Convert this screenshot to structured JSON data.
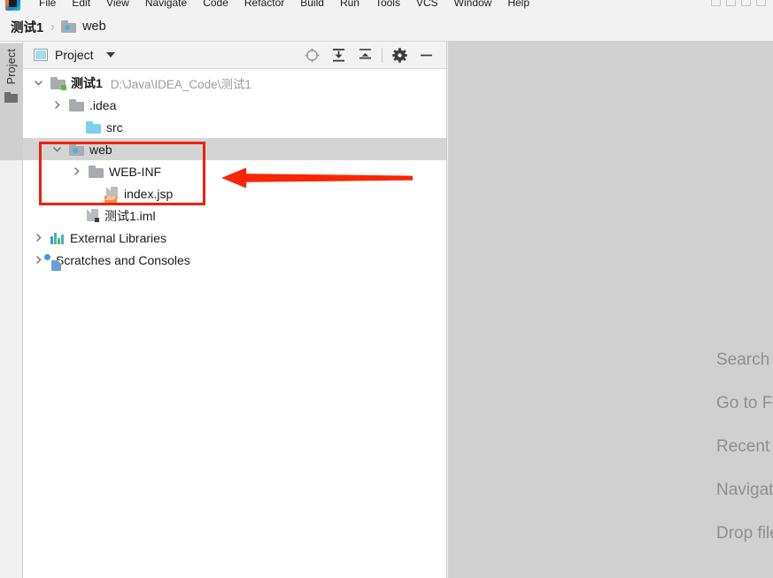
{
  "window": {
    "menu_items": [
      {
        "label": "File",
        "mnemonic": "F"
      },
      {
        "label": "Edit",
        "mnemonic": "E"
      },
      {
        "label": "View",
        "mnemonic": "V"
      },
      {
        "label": "Navigate",
        "mnemonic": "N"
      },
      {
        "label": "Code",
        "mnemonic": "C"
      },
      {
        "label": "Refactor",
        "mnemonic": "R"
      },
      {
        "label": "Build",
        "mnemonic": "B"
      },
      {
        "label": "Run",
        "mnemonic": "R"
      },
      {
        "label": "Tools",
        "mnemonic": "T"
      },
      {
        "label": "VCS",
        "mnemonic": "S"
      },
      {
        "label": "Window",
        "mnemonic": "W"
      },
      {
        "label": "Help",
        "mnemonic": "H"
      }
    ]
  },
  "navbar": {
    "root": "测试1",
    "separator": "›",
    "current": "web",
    "current_icon": "web-folder-icon"
  },
  "toolstrip": {
    "project_button_label": "Project",
    "project_button_icon": "project-folder-icon"
  },
  "project_panel": {
    "title": "Project",
    "title_icon": "project-view-icon",
    "dropdown_icon": "chevron-down-icon",
    "tools": [
      {
        "name": "locate-in-tree-icon",
        "title": "Select Opened File"
      },
      {
        "name": "expand-all-icon",
        "title": "Expand All"
      },
      {
        "name": "collapse-all-icon",
        "title": "Collapse All"
      },
      {
        "name": "settings-gear-icon",
        "title": "Settings"
      },
      {
        "name": "hide-minimize-icon",
        "title": "Hide"
      }
    ]
  },
  "tree": {
    "nodes": [
      {
        "label": "测试1",
        "path_hint": "D:\\Java\\IDEA_Code\\测试1",
        "icon": "module-folder-icon",
        "indent": 0,
        "expanded": true,
        "bold": true,
        "selected": false
      },
      {
        "label": ".idea",
        "path_hint": "",
        "icon": "folder-icon",
        "indent": 1,
        "expanded": false,
        "bold": false,
        "selected": false
      },
      {
        "label": "src",
        "path_hint": "",
        "icon": "source-root-folder-icon",
        "indent": 1,
        "expanded": null,
        "bold": false,
        "selected": false
      },
      {
        "label": "web",
        "path_hint": "",
        "icon": "web-resource-folder-icon",
        "indent": 1,
        "expanded": true,
        "bold": false,
        "selected": true
      },
      {
        "label": "WEB-INF",
        "path_hint": "",
        "icon": "folder-icon",
        "indent": 2,
        "expanded": false,
        "bold": false,
        "selected": false
      },
      {
        "label": "index.jsp",
        "path_hint": "",
        "icon": "jsp-file-icon",
        "indent": 2,
        "expanded": null,
        "bold": false,
        "selected": false
      },
      {
        "label": "测试1.iml",
        "path_hint": "",
        "icon": "iml-file-icon",
        "indent": 1,
        "expanded": null,
        "bold": false,
        "selected": false
      },
      {
        "label": "External Libraries",
        "path_hint": "",
        "icon": "libraries-icon",
        "indent": 0,
        "expanded": false,
        "bold": false,
        "selected": false
      },
      {
        "label": "Scratches and Consoles",
        "path_hint": "",
        "icon": "scratches-icon",
        "indent": 0,
        "expanded": false,
        "bold": false,
        "selected": false
      }
    ]
  },
  "editor": {
    "watermark_lines": [
      "Search Everywhere",
      "Go to File",
      "Recent Files",
      "Navigation Bar",
      "Drop files here to open"
    ]
  },
  "annotations": {
    "highlight_box_color": "#f02000",
    "arrow_color": "#f82500",
    "arrow_direction": "left",
    "highlight_target": "web-folder-subtree"
  }
}
